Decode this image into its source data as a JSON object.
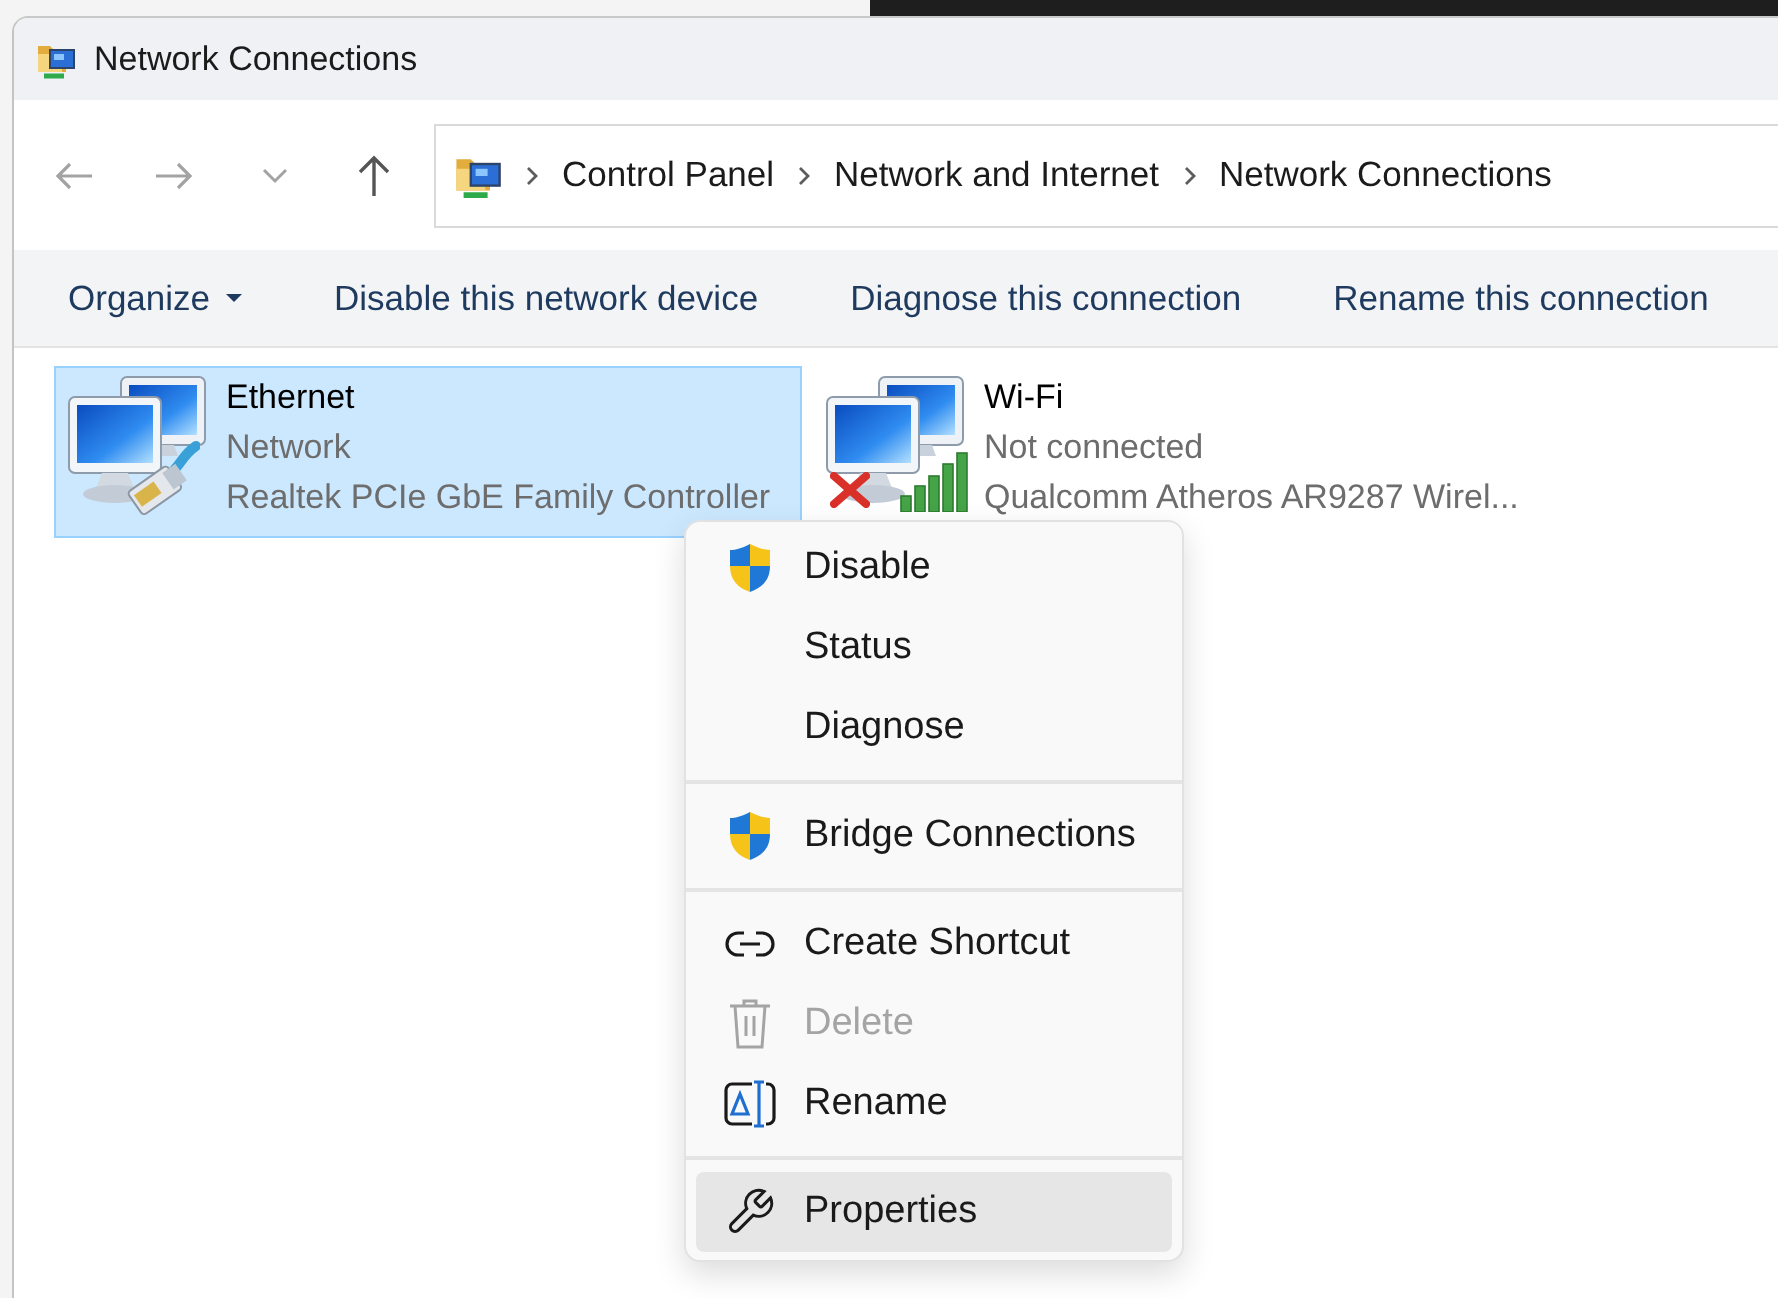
{
  "window": {
    "title": "Network Connections"
  },
  "nav_buttons": [
    {
      "kind": "back",
      "disabled": true
    },
    {
      "kind": "forward",
      "disabled": true
    },
    {
      "kind": "recent",
      "disabled": true
    },
    {
      "kind": "up",
      "disabled": false
    }
  ],
  "address_bar": {
    "breadcrumbs": [
      "Control Panel",
      "Network and Internet",
      "Network Connections"
    ]
  },
  "toolbar": [
    {
      "label": "Organize",
      "kind": "menu"
    },
    {
      "label": "Disable this network device",
      "kind": "command"
    },
    {
      "label": "Diagnose this connection",
      "kind": "command"
    },
    {
      "label": "Rename this connection",
      "kind": "command"
    }
  ],
  "connections": [
    {
      "name": "Ethernet",
      "status": "Network",
      "device": "Realtek PCIe GbE Family Controller",
      "kind": "wired",
      "connected": true,
      "selected": true
    },
    {
      "name": "Wi-Fi",
      "status": "Not connected",
      "device": "Qualcomm Atheros AR9287 Wirel...",
      "kind": "wireless",
      "connected": false,
      "selected": false
    }
  ],
  "context_menu": {
    "groups": [
      {
        "items": [
          {
            "label": "Disable",
            "kind": "admin",
            "disabled": false,
            "selected": false
          },
          {
            "label": "Status",
            "kind": "plain",
            "disabled": false,
            "selected": false
          },
          {
            "label": "Diagnose",
            "kind": "plain",
            "disabled": false,
            "selected": false
          }
        ]
      },
      {
        "items": [
          {
            "label": "Bridge Connections",
            "kind": "admin",
            "disabled": false,
            "selected": false
          }
        ]
      },
      {
        "items": [
          {
            "label": "Create Shortcut",
            "kind": "shortcut",
            "disabled": false,
            "selected": false
          },
          {
            "label": "Delete",
            "kind": "delete",
            "disabled": true,
            "selected": false
          },
          {
            "label": "Rename",
            "kind": "rename",
            "disabled": false,
            "selected": false
          }
        ]
      },
      {
        "items": [
          {
            "label": "Properties",
            "kind": "properties",
            "disabled": false,
            "selected": true
          }
        ]
      }
    ]
  }
}
